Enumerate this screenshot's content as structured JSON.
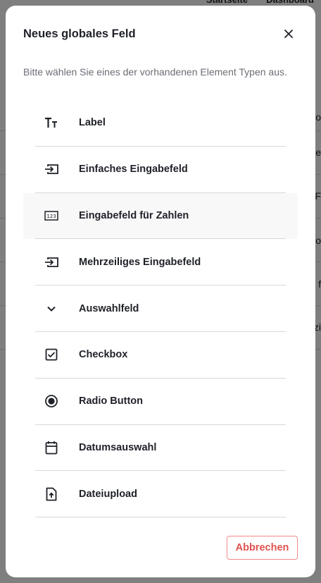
{
  "background": {
    "nav": [
      "Startseite",
      "Dashboard"
    ],
    "rows": [
      "lo",
      "ie",
      "F",
      "o",
      "f",
      "zi"
    ]
  },
  "modal": {
    "title": "Neues globales Feld",
    "subtitle": "Bitte wählen Sie eines der vorhandenen Element Typen aus.",
    "close_icon": "close-icon",
    "cancel_label": "Abbrechen",
    "cancel_color": "#e0524f"
  },
  "items": [
    {
      "label": "Label",
      "icon": "text-icon"
    },
    {
      "label": "Einfaches Eingabefeld",
      "icon": "input-icon"
    },
    {
      "label": "Eingabefeld für Zahlen",
      "icon": "number-input-icon"
    },
    {
      "label": "Mehrzeiliges Eingabefeld",
      "icon": "input-icon"
    },
    {
      "label": "Auswahlfeld",
      "icon": "chevron-down-icon"
    },
    {
      "label": "Checkbox",
      "icon": "checkbox-icon"
    },
    {
      "label": "Radio Button",
      "icon": "radio-icon"
    },
    {
      "label": "Datumsauswahl",
      "icon": "calendar-icon"
    },
    {
      "label": "Dateiupload",
      "icon": "file-upload-icon"
    }
  ]
}
